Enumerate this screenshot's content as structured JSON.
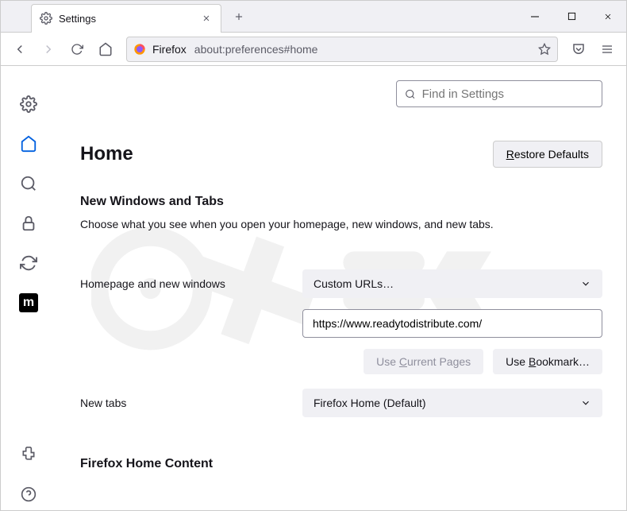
{
  "tab": {
    "title": "Settings"
  },
  "toolbar": {
    "url_label": "Firefox",
    "url_text": "about:preferences#home"
  },
  "search": {
    "placeholder": "Find in Settings"
  },
  "page": {
    "title": "Home",
    "restore": "Restore Defaults",
    "section1_title": "New Windows and Tabs",
    "section1_desc": "Choose what you see when you open your homepage, new windows, and new tabs.",
    "homepage_label": "Homepage and new windows",
    "homepage_select": "Custom URLs…",
    "homepage_url": "https://www.readytodistribute.com/",
    "use_current": "Use Current Pages",
    "use_bookmark": "Use Bookmark…",
    "newtabs_label": "New tabs",
    "newtabs_select": "Firefox Home (Default)",
    "section2_title": "Firefox Home Content"
  }
}
